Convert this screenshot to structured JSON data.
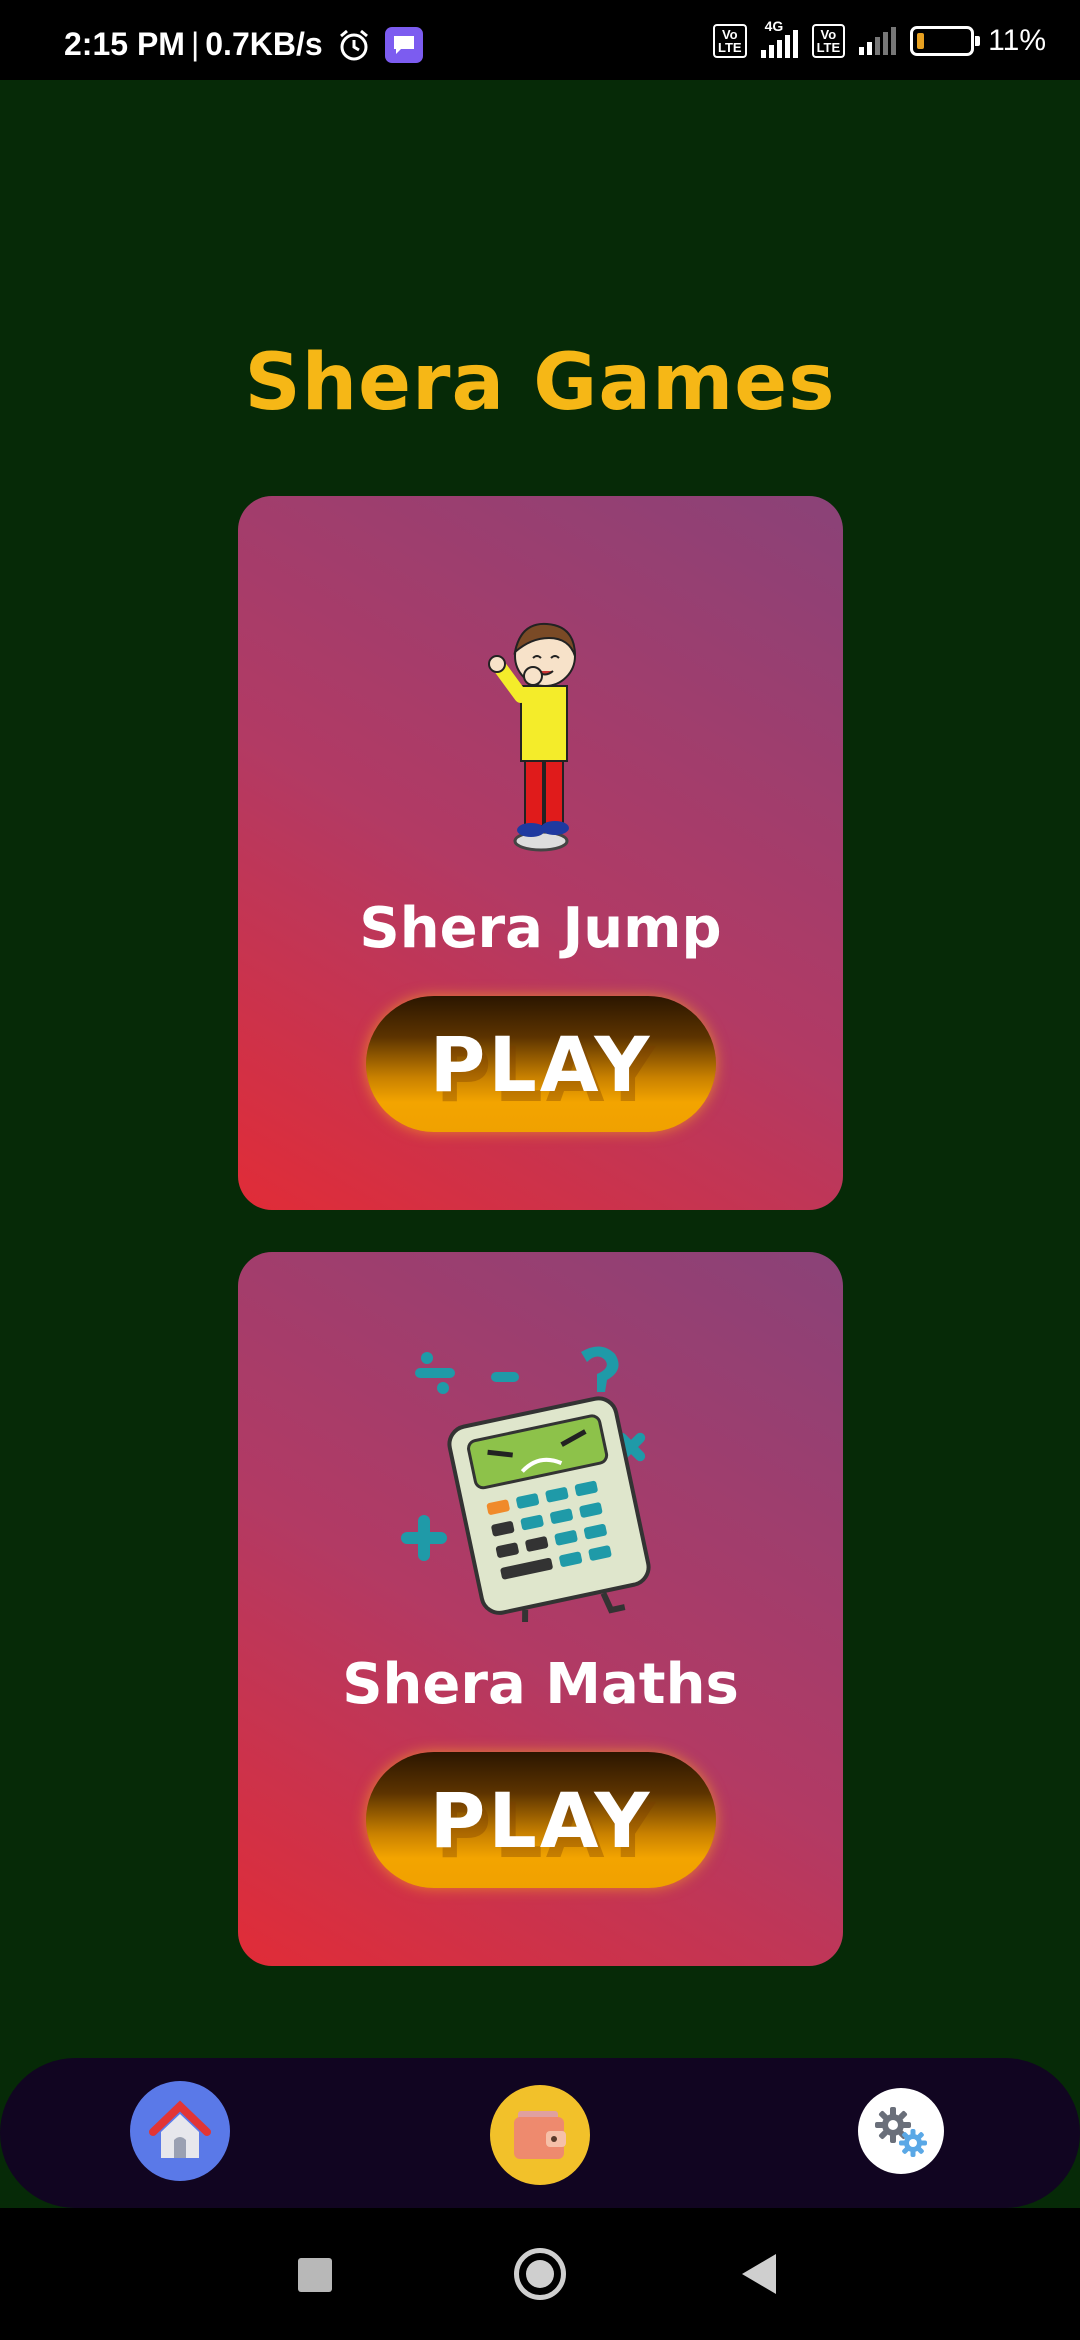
{
  "status_bar": {
    "time": "2:15 PM",
    "network_speed": "0.7KB/s",
    "volte_label": "Vo\nLTE",
    "network_type": "4G",
    "battery_percent": "11%",
    "icons": [
      "alarm-icon",
      "message-icon",
      "volte-icon",
      "signal-icon",
      "battery-icon"
    ]
  },
  "page": {
    "title": "Shera Games"
  },
  "games": [
    {
      "title": "Shera Jump",
      "play_label": "PLAY",
      "image": "jumping-boy-image"
    },
    {
      "title": "Shera Maths",
      "play_label": "PLAY",
      "image": "calculator-image"
    }
  ],
  "bottom_nav": {
    "items": [
      {
        "icon": "home-icon"
      },
      {
        "icon": "wallet-icon"
      },
      {
        "icon": "settings-gears-icon"
      }
    ]
  },
  "colors": {
    "background": "#062a07",
    "title": "#f6b716",
    "card_gradient": [
      "#e12c37",
      "#b23a64",
      "#8a4278"
    ],
    "play_button": "#f3a400",
    "bottom_nav": "#110521"
  }
}
